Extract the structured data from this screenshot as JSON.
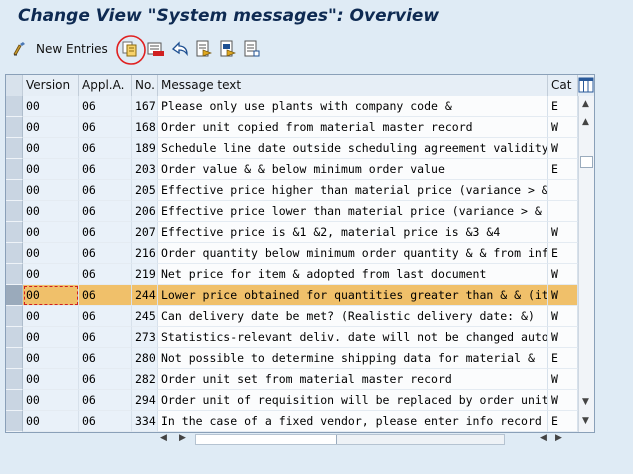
{
  "window": {
    "title": "Change View \"System messages\": Overview"
  },
  "toolbar": {
    "new_entries_label": "New Entries",
    "icons": [
      "edit-glasses-icon",
      "copy-as-icon",
      "delete-icon",
      "undo-icon",
      "select-all-icon",
      "select-block-icon",
      "deselect-all-icon"
    ]
  },
  "table": {
    "columns": [
      "Version",
      "Appl.A.",
      "No.",
      "Message text",
      "Cat"
    ],
    "rows": [
      [
        "00",
        "06",
        "167",
        "Please only use plants with company code &",
        "E"
      ],
      [
        "00",
        "06",
        "168",
        "Order unit copied from material master record",
        "W"
      ],
      [
        "00",
        "06",
        "189",
        "Schedule line date outside scheduling agreement validity period",
        "W"
      ],
      [
        "00",
        "06",
        "203",
        "Order value & & below minimum order value",
        "E"
      ],
      [
        "00",
        "06",
        "205",
        "Effective price higher than material price (variance > & &)",
        ""
      ],
      [
        "00",
        "06",
        "206",
        "Effective price lower than material price (variance > & &)",
        ""
      ],
      [
        "00",
        "06",
        "207",
        "Effective price is &1 &2, material price is &3 &4",
        "W"
      ],
      [
        "00",
        "06",
        "216",
        "Order quantity below minimum order quantity & & from info record",
        "E"
      ],
      [
        "00",
        "06",
        "219",
        "Net price for item & adopted from last document",
        "W"
      ],
      [
        "00",
        "06",
        "244",
        "Lower price obtained for quantities greater than & & (item &, materia..",
        "W"
      ],
      [
        "00",
        "06",
        "245",
        "Can delivery date be met? (Realistic delivery date: &)",
        "W"
      ],
      [
        "00",
        "06",
        "273",
        "Statistics-relevant deliv. date will not be changed automatically",
        "W"
      ],
      [
        "00",
        "06",
        "280",
        "Not possible to determine shipping data for material &",
        "E"
      ],
      [
        "00",
        "06",
        "282",
        "Order unit set from material master record",
        "W"
      ],
      [
        "00",
        "06",
        "294",
        "Order unit of requisition will be replaced by order unit from info record",
        "W"
      ],
      [
        "00",
        "06",
        "334",
        "In the case of a fixed vendor, please enter info record",
        "E"
      ]
    ],
    "highlighted_row": 9
  },
  "colors": {
    "highlight": "#f0c06a",
    "title": "#0e2a52",
    "annotation": "#e02020"
  }
}
